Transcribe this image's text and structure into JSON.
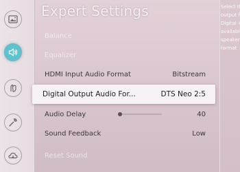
{
  "screen": {
    "title": "Expert Settings"
  },
  "sidebar": {
    "items": [
      {
        "icon": "picture-icon"
      },
      {
        "icon": "sound-icon",
        "active": true
      },
      {
        "icon": "broadcasting-icon"
      },
      {
        "icon": "support-icon"
      },
      {
        "icon": "general-icon"
      }
    ]
  },
  "menu": {
    "items": [
      {
        "label": "Balance",
        "value": "",
        "dim": true
      },
      {
        "label": "Equalizer",
        "value": "",
        "dim": true
      },
      {
        "label": "HDMI Input Audio Format",
        "value": "Bitstream"
      },
      {
        "label": "Digital Output Audio For...",
        "value": "DTS Neo 2:5",
        "selected": true
      },
      {
        "label": "Audio Delay",
        "value": "40",
        "slider_fraction": 0.05
      },
      {
        "label": "Sound Feedback",
        "value": "Low"
      },
      {
        "label": "Reset Sound",
        "value": "",
        "dim": true
      }
    ]
  },
  "description": {
    "lines": [
      "Select th",
      "output fo",
      "Digital +",
      "available",
      "speakers",
      "format"
    ]
  },
  "colors": {
    "accent": "#5fc3cf",
    "selected_background": "#f7f2f5",
    "title_text": "#f4eff2"
  }
}
